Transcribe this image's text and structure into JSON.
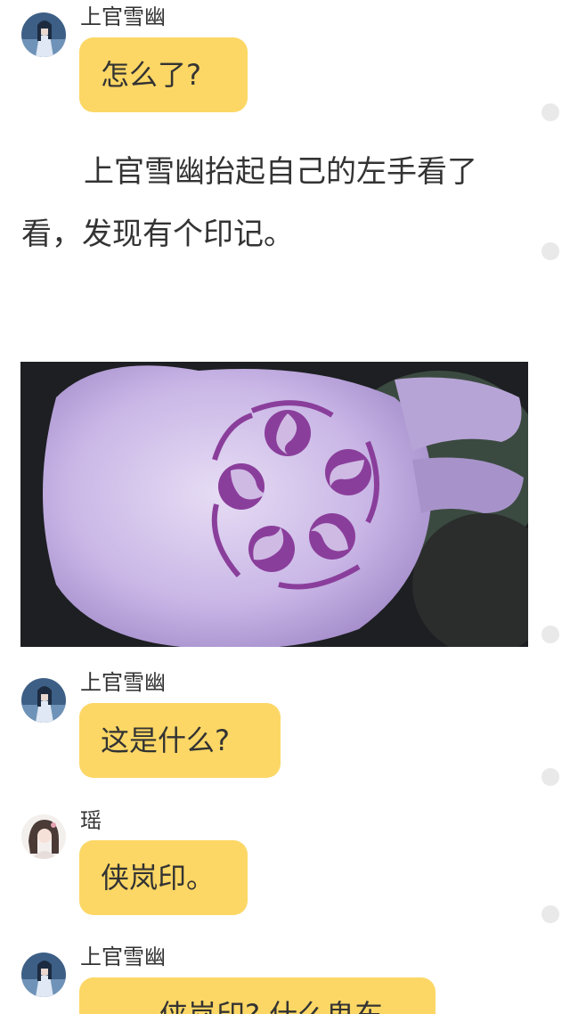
{
  "messages": [
    {
      "sender": "上官雪幽",
      "text": "怎么了?",
      "avatar": "girl-blue-avatar"
    },
    {
      "sender": "上官雪幽",
      "text": "这是什么?",
      "avatar": "girl-blue-avatar"
    },
    {
      "sender": "瑶",
      "text": "侠岚印。",
      "avatar": "girl-white-avatar"
    },
    {
      "sender": "上官雪幽",
      "text": "侠岚印? 什么鬼东",
      "avatar": "girl-blue-avatar"
    }
  ],
  "narration": {
    "line1": "上官雪幽抬起自己的左手看了",
    "line2": "看，发现有个印记。"
  },
  "image": {
    "icon": "palm-mark-image",
    "subject": "hand with five-swirl mark"
  },
  "colors": {
    "bubble": "#fcd765",
    "dot": "#e9e9e9",
    "mark": "#8a3e9b"
  }
}
